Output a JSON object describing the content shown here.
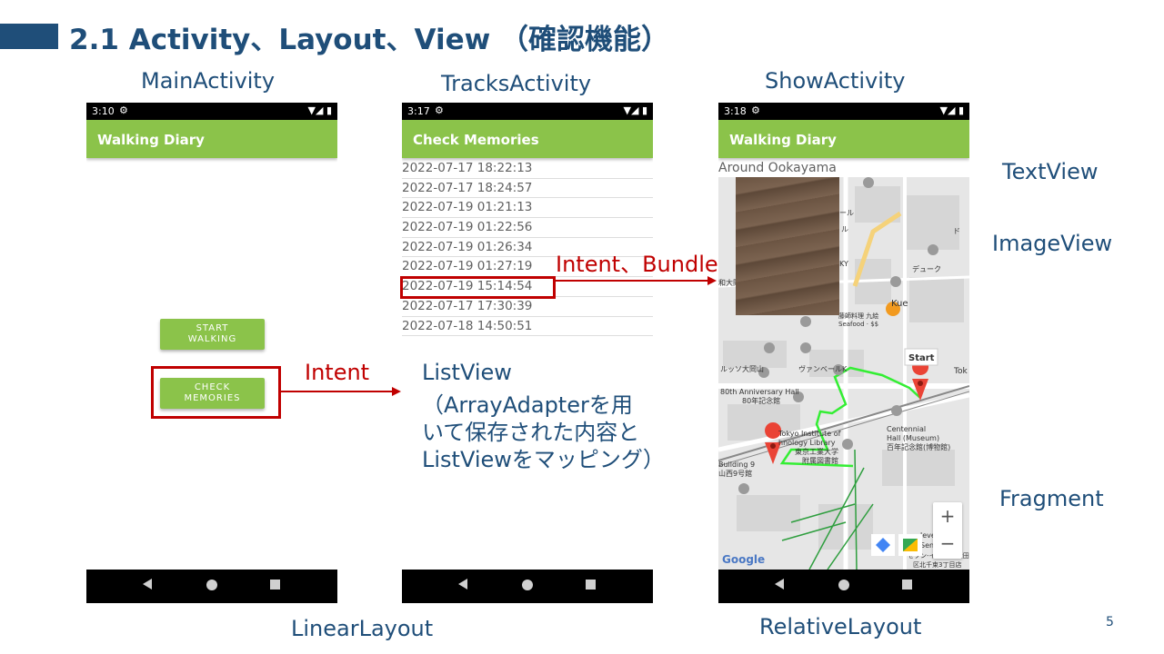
{
  "slide": {
    "title": "2.1 Activity、Layout、View （確認機能）",
    "page_number": "5"
  },
  "activity_labels": {
    "main": "MainActivity",
    "tracks": "TracksActivity",
    "show": "ShowActivity"
  },
  "layout_labels": {
    "linear": "LinearLayout",
    "relative": "RelativeLayout"
  },
  "view_labels": {
    "textview": "TextView",
    "imageview": "ImageView",
    "fragment": "Fragment",
    "listview_title": "ListView",
    "listview_desc": [
      "（ArrayAdapterを用",
      "いて保存された内容と",
      "ListViewをマッピング）"
    ]
  },
  "arrow_labels": {
    "intent": "Intent",
    "intent_bundle": "Intent、Bundle"
  },
  "phone_main": {
    "time": "3:10",
    "app_title": "Walking Diary",
    "start_button": [
      "START",
      "WALKING"
    ],
    "check_button": [
      "CHECK",
      "MEMORIES"
    ]
  },
  "phone_tracks": {
    "time": "3:17",
    "app_title": "Check Memories",
    "items": [
      "2022-07-17 18:22:13",
      "2022-07-17 18:24:57",
      "2022-07-19 01:21:13",
      "2022-07-19 01:22:56",
      "2022-07-19 01:26:34",
      "2022-07-19 01:27:19",
      "2022-07-19 15:14:54",
      "2022-07-17 17:30:39",
      "2022-07-18 14:50:51"
    ]
  },
  "phone_show": {
    "time": "3:18",
    "app_title": "Walking Diary",
    "caption": "Around Ookayama",
    "map_labels": {
      "start": "Start",
      "kue": "Kue",
      "kue_sub": "藤師料理 九絵",
      "kue_sub2": "Seafood · $$",
      "kky": "KY",
      "deyuku": "デューク",
      "ru": "ール",
      "ru2": "ル",
      "wa": "和大岡",
      "tok": "Tok",
      "ruttsu": "ルッソ大岡山",
      "vanbeel": "ヴァンベールK",
      "anniv1": "80th Anniversary Hall",
      "anniv2": "80年記念館",
      "tokyo1": "Tokyo Institute of",
      "tokyo2": "hnology Library",
      "tokyo3": "東京工業大学",
      "tokyo4": "附属図書館",
      "centennial1": "Centennial",
      "centennial2": "Hall (Museum)",
      "centennial3": "百年記念館(博物館)",
      "building1": "Building 9",
      "building2": "山西9号館",
      "seven1": "leven - Ota",
      "seven2": "Senzoku 3",
      "seven3": "セブン-イレブン 大田",
      "seven4": "区北千束3丁目店",
      "do": "ド",
      "google": "Google",
      "zoom_in": "+",
      "zoom_out": "−"
    }
  },
  "colors": {
    "title_blue": "#1f4e79",
    "accent_red": "#c00000",
    "app_green": "#8bc34a"
  },
  "icons": {
    "status_gear": "⚙",
    "status_right": "▼◢ ▮"
  }
}
